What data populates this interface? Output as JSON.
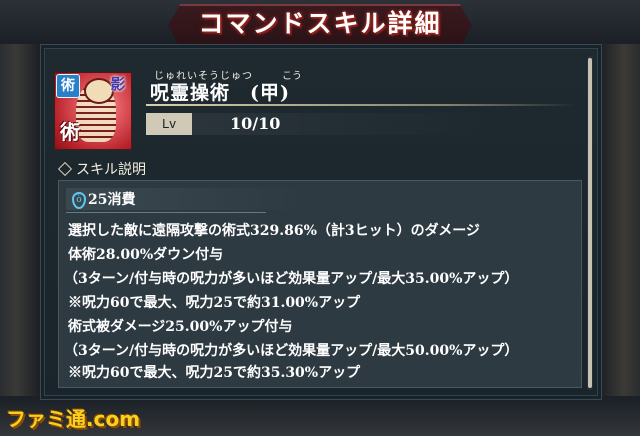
{
  "header": {
    "title": "コマンドスキル詳細"
  },
  "skill": {
    "ruby_main": "じゅれいそうじゅつ",
    "ruby_sub": "こう",
    "name": "呪霊操術　(甲)",
    "badges": {
      "type_top_left": "術",
      "type_top_right": "影",
      "type_bottom_left": "術"
    },
    "level_label": "Lv",
    "level_value": "10/10"
  },
  "description": {
    "section_title": "スキル説明",
    "cost": "25消費",
    "lines": [
      "選択した敵に遠隔攻撃の術式329.86%（計3ヒット）のダメージ",
      "体術28.00%ダウン付与",
      "（3ターン/付与時の呪力が多いほど効果量アップ/最大35.00%アップ）",
      "※呪力60で最大、呪力25で約31.00%アップ",
      "術式被ダメージ25.00%アップ付与",
      "（3ターン/付与時の呪力が多いほど効果量アップ/最大50.00%アップ）",
      "※呪力60で最大、呪力25で約35.30%アップ"
    ]
  },
  "watermark": "ファミ通.com",
  "colors": {
    "accent_red": "#c0392b",
    "cost_icon": "#5ec8f0",
    "watermark": "#f7d020"
  }
}
